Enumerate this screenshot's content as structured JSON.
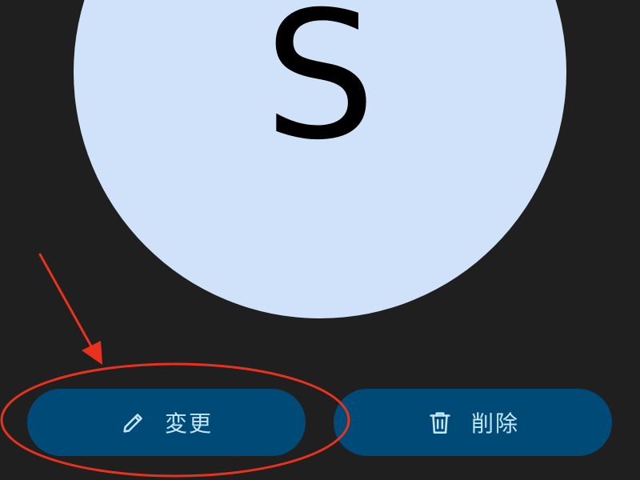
{
  "profile": {
    "avatar_initial": "S"
  },
  "actions": {
    "change_label": "変更",
    "change_icon": "pencil-icon",
    "delete_label": "削除",
    "delete_icon": "trash-icon"
  },
  "colors": {
    "background": "#1f1f1f",
    "avatar_fill": "#cfe2f9",
    "button_fill": "#004a77",
    "button_text": "#c2e7ff",
    "annotation": "#e8321e"
  }
}
